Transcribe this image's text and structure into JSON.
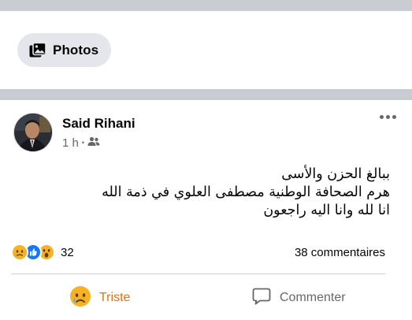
{
  "filter": {
    "photos_label": "Photos"
  },
  "post": {
    "author": "Said Rihani",
    "time": "1 h",
    "time_separator": "•",
    "text_lines": [
      "ببالغ الحزن والأسى",
      "هرم الصحافة الوطنية مصطفى العلوي في ذمة الله",
      "انا لله وانا اليه راجعون"
    ],
    "reactions": {
      "icons": [
        "sad",
        "like",
        "wow"
      ],
      "count": "32"
    },
    "comments_count": "38 commentaires",
    "actions": {
      "reaction_label": "Triste",
      "comment_label": "Commenter"
    }
  },
  "colors": {
    "reaction_active": "#e9710f",
    "secondary_text": "#65676b",
    "chip_background": "#e4e6eb",
    "separator_band": "#c9ccd1",
    "like_blue": "#1877f2"
  }
}
